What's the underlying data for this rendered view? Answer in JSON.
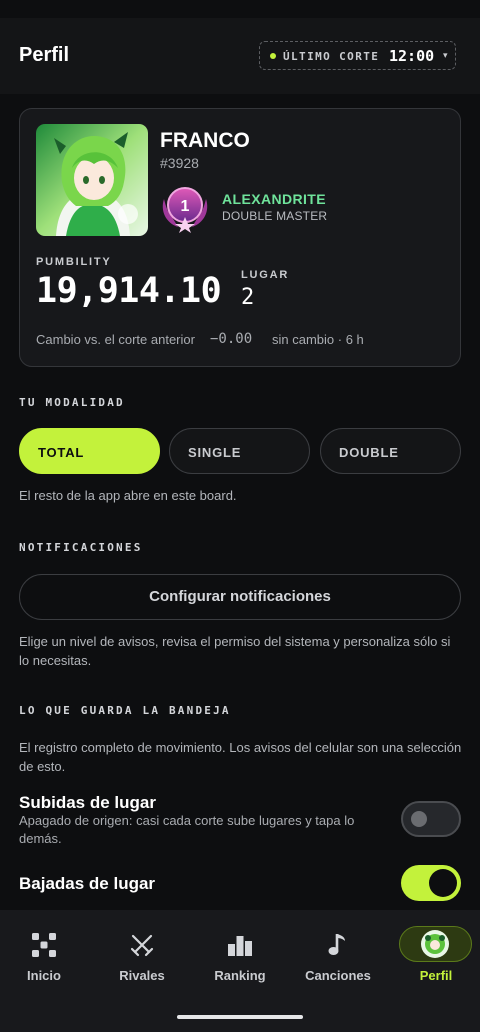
{
  "header": {
    "title": "Perfil",
    "cutoff_label": "ÚLTIMO CORTE",
    "cutoff_time": "12:00",
    "cutoff_caret": "▾"
  },
  "profile": {
    "name": "FRANCO",
    "tag": "#3928",
    "rank_name": "ALEXANDRITE",
    "rank_tier": "DOUBLE MASTER",
    "rank_number": "1",
    "pumbility_label": "PUMBILITY",
    "pumbility_value": "19,914.10",
    "place_label": "LUGAR",
    "place_value": "2",
    "change_label": "Cambio vs. el corte anterior",
    "change_value": "−0.00",
    "change_status": "sin cambio · 6 h"
  },
  "mode": {
    "section_label": "TU MODALIDAD",
    "options": [
      "TOTAL",
      "SINGLE",
      "DOUBLE"
    ],
    "selected": "TOTAL",
    "helper": "El resto de la app abre en este board."
  },
  "notifications": {
    "section_label": "NOTIFICACIONES",
    "button_label": "Configurar notificaciones",
    "helper": "Elige un nivel de avisos, revisa el permiso del sistema y personaliza sólo si lo necesitas."
  },
  "tray": {
    "section_label": "LO QUE GUARDA LA BANDEJA",
    "helper": "El registro completo de movimiento. Los avisos del celular son una selección de esto.",
    "toggles": [
      {
        "title": "Subidas de lugar",
        "desc": "Apagado de origen: casi cada corte sube lugares y tapa lo demás.",
        "on": false
      },
      {
        "title": "Bajadas de lugar",
        "desc": "",
        "on": true
      }
    ]
  },
  "nav": {
    "items": [
      {
        "label": "Inicio",
        "icon": "grid-dots-icon"
      },
      {
        "label": "Rivales",
        "icon": "crossed-swords-icon"
      },
      {
        "label": "Ranking",
        "icon": "podium-icon"
      },
      {
        "label": "Canciones",
        "icon": "music-note-icon"
      },
      {
        "label": "Perfil",
        "icon": "avatar-icon"
      }
    ],
    "active": "Perfil"
  },
  "colors": {
    "accent": "#c3f23b",
    "rank_green": "#6fe39b",
    "background": "#0d0e10",
    "card": "#17181b"
  }
}
